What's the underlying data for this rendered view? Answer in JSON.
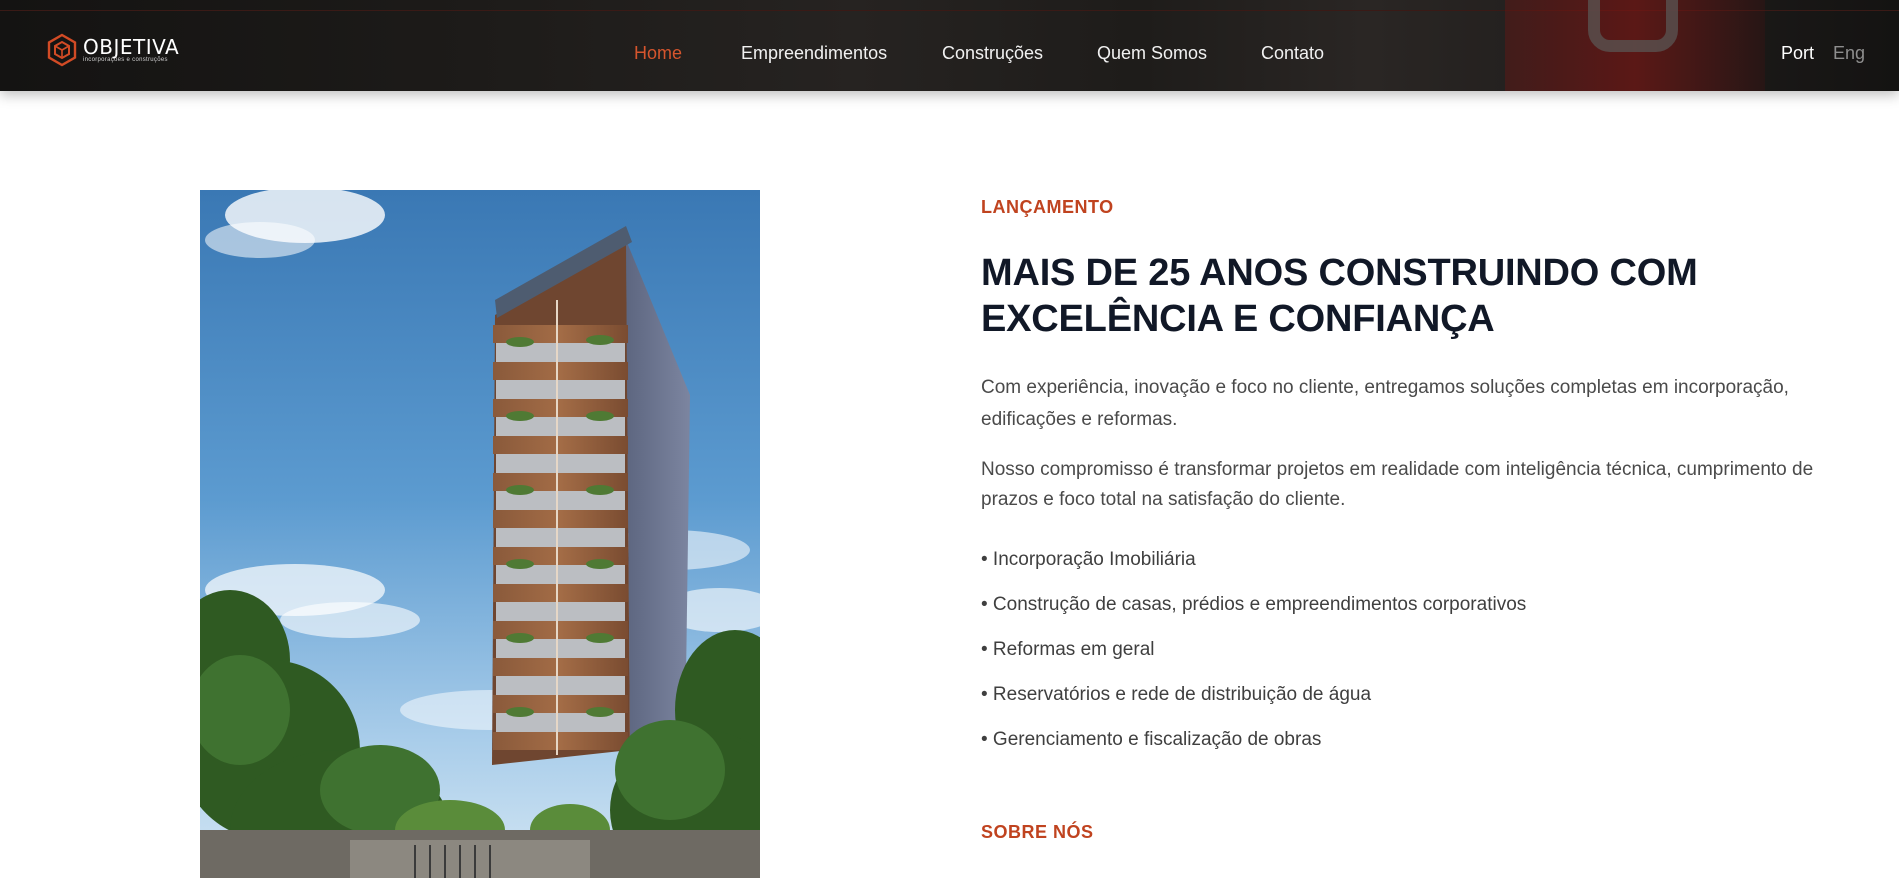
{
  "brand": {
    "name": "OBJETIVA",
    "tagline": "incorporações e construções",
    "accent_color": "#c0431f",
    "logo_icon": "hexagon-cube-icon"
  },
  "nav": {
    "items": [
      {
        "label": "Home",
        "active": true
      },
      {
        "label": "Empreendimentos",
        "active": false
      },
      {
        "label": "Construções",
        "active": false
      },
      {
        "label": "Quem Somos",
        "active": false
      },
      {
        "label": "Contato",
        "active": false
      }
    ]
  },
  "language": {
    "options": [
      "Port",
      "Eng"
    ],
    "selected": "Port"
  },
  "hero": {
    "eyebrow": "LANÇAMENTO",
    "headline_line1": "MAIS DE 25 ANOS CONSTRUINDO COM",
    "headline_line2": "EXCELÊNCIA E CONFIANÇA",
    "paragraph1": "Com experiência, inovação e foco no cliente, entregamos soluções completas em incorporação, edificações e reformas.",
    "paragraph2": "Nosso compromisso é transformar projetos em realidade com inteligência técnica, cumprimento de prazos e foco total na satisfação do cliente.",
    "services": [
      "• Incorporação Imobiliária",
      "• Construção de casas, prédios e empreendimentos corporativos",
      "• Reformas em geral",
      "• Reservatórios e rede de distribuição de água",
      "• Gerenciamento e fiscalização de obras"
    ],
    "next_section_label": "SOBRE NÓS"
  }
}
